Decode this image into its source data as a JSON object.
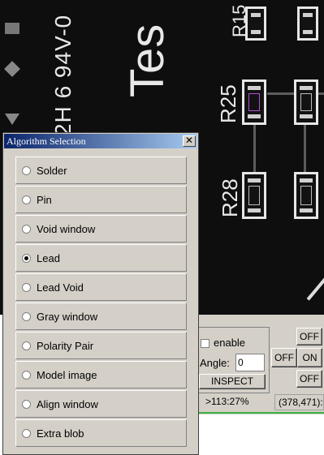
{
  "pcb": {
    "silk_left": "2H 6 94V-0",
    "silk_tes": "Tes",
    "ref_r15": "R15",
    "ref_r25": "R25",
    "ref_r28": "R28"
  },
  "dialog": {
    "title": "Algorithm Selection",
    "close": "✕",
    "options": [
      {
        "label": "Solder",
        "selected": false
      },
      {
        "label": "Pin",
        "selected": false
      },
      {
        "label": "Void window",
        "selected": false
      },
      {
        "label": "Lead",
        "selected": true
      },
      {
        "label": "Lead Void",
        "selected": false
      },
      {
        "label": "Gray window",
        "selected": false
      },
      {
        "label": "Polarity Pair",
        "selected": false
      },
      {
        "label": "Model image",
        "selected": false
      },
      {
        "label": "Align window",
        "selected": false
      },
      {
        "label": "Extra blob",
        "selected": false
      }
    ]
  },
  "controls": {
    "enable_label": "enable",
    "angle_label": "Angle:",
    "angle_value": "0",
    "inspect_label": "INSPECT",
    "off_top": "OFF",
    "off_left": "OFF",
    "on_mid": "ON",
    "off_bottom": "OFF",
    "zoom_status": ">113:27%",
    "coord_status": "(378,471):"
  }
}
